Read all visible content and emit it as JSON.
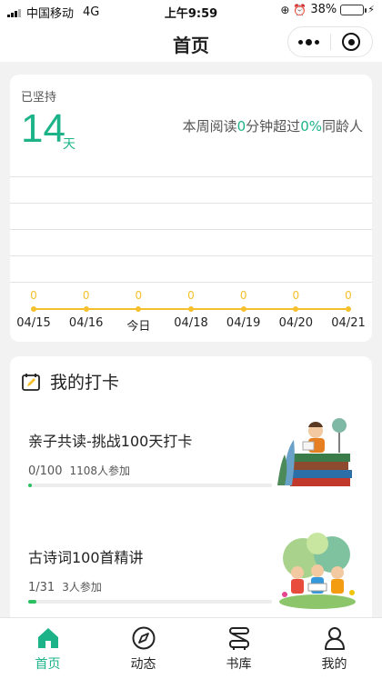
{
  "status_bar": {
    "carrier": "中国移动",
    "network": "4G",
    "time": "上午9:59",
    "battery": "38%",
    "battery_level": 0.38
  },
  "nav": {
    "title": "首页",
    "more_icon": "more-dots-icon",
    "close_icon": "target-icon"
  },
  "stats": {
    "persist_label": "已坚持",
    "days": "14",
    "days_unit": "天",
    "weekly_prefix": "本周阅读",
    "weekly_minutes": "0",
    "weekly_middle": "分钟超过",
    "weekly_percent": "0%",
    "weekly_suffix": "同龄人",
    "accent_color": "#1db388",
    "line_color": "#f5c02d"
  },
  "chart_data": {
    "type": "line",
    "categories": [
      "04/15",
      "04/16",
      "今日",
      "04/18",
      "04/19",
      "04/20",
      "04/21"
    ],
    "values": [
      0,
      0,
      0,
      0,
      0,
      0,
      0
    ],
    "value_labels": [
      "0",
      "0",
      "0",
      "0",
      "0",
      "0",
      "0"
    ],
    "grid": true
  },
  "checkin": {
    "section_title": "我的打卡",
    "section_icon": "edit-calendar-icon",
    "items": [
      {
        "title": "亲子共读-挑战100天打卡",
        "progress_text": "0/100",
        "participants": "1108人参加",
        "progress": 0.01,
        "thumb_icon": "kids-reading-books-illustration"
      },
      {
        "title": "古诗词100首精讲",
        "progress_text": "1/31",
        "participants": "3人参加",
        "progress": 0.032,
        "thumb_icon": "kids-reading-garden-illustration"
      }
    ]
  },
  "tab_bar": {
    "tabs": [
      {
        "label": "首页",
        "icon": "home-icon",
        "active": true
      },
      {
        "label": "动态",
        "icon": "compass-icon",
        "active": false
      },
      {
        "label": "书库",
        "icon": "bookshelf-icon",
        "active": false
      },
      {
        "label": "我的",
        "icon": "user-icon",
        "active": false
      }
    ],
    "active_color": "#1db388"
  }
}
